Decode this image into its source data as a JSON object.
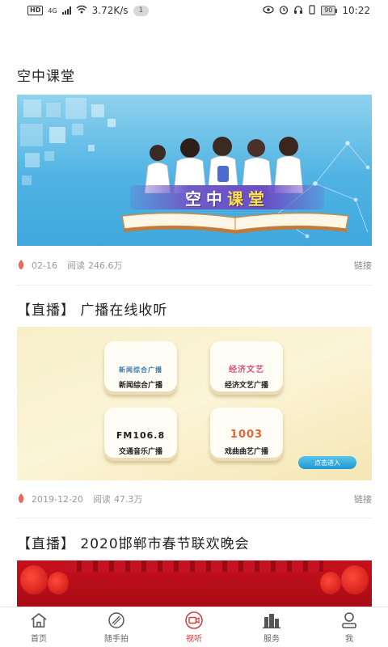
{
  "status_bar": {
    "hd": "HD",
    "network": "4G",
    "speed": "3.72K/s",
    "notification_count": "1",
    "battery": "90",
    "time": "10:22"
  },
  "sections": [
    {
      "title": "空中课堂",
      "banner_text": "空中课堂",
      "date": "02-16",
      "reads_label": "阅读",
      "reads": "246.6万",
      "link": "链接"
    },
    {
      "title": "【直播】 广播在线收听",
      "date": "2019-12-20",
      "reads_label": "阅读",
      "reads": "47.3万",
      "link": "链接",
      "tiles": [
        {
          "logo": "新闻综合广播",
          "label": "新闻综合广播"
        },
        {
          "logo": "经济文艺",
          "label": "经济文艺广播"
        },
        {
          "logo": "FM106.8",
          "label": "交通音乐广播"
        },
        {
          "logo": "1003",
          "label": "戏曲曲艺广播"
        }
      ],
      "enter_button": "点击进入"
    },
    {
      "title": "【直播】 2020邯郸市春节联欢晚会"
    }
  ],
  "bottom_nav": [
    {
      "label": "首页",
      "icon": "home-icon"
    },
    {
      "label": "随手拍",
      "icon": "camera-lens-icon"
    },
    {
      "label": "视听",
      "icon": "video-icon",
      "active": true
    },
    {
      "label": "服务",
      "icon": "buildings-icon"
    },
    {
      "label": "我",
      "icon": "user-icon"
    }
  ],
  "colors": {
    "accent": "#d13b3b",
    "meta_text": "#9a9a9a",
    "fire": "#e86a5a"
  }
}
